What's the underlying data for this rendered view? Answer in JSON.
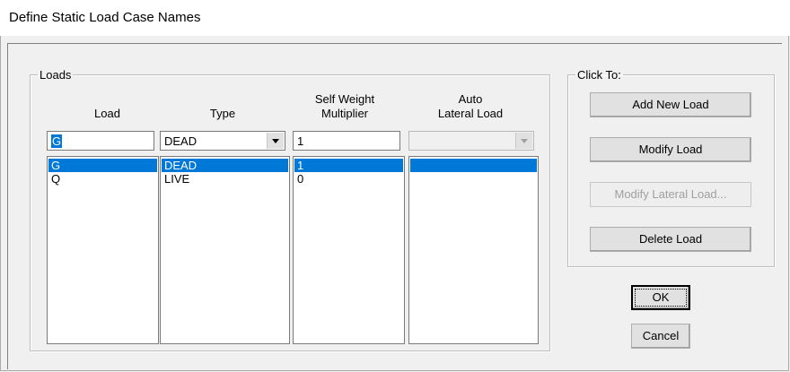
{
  "window": {
    "title": "Define Static Load Case Names"
  },
  "loads": {
    "legend": "Loads",
    "headers": {
      "load": "Load",
      "type": "Type",
      "self_weight": [
        "Self Weight",
        "Multiplier"
      ],
      "auto_lateral": [
        "Auto",
        "Lateral Load"
      ]
    },
    "edit_row": {
      "load": "G",
      "type": "DEAD",
      "multiplier": "1",
      "auto_lateral": ""
    },
    "rows": [
      {
        "load": "G",
        "type": "DEAD",
        "multiplier": "1",
        "selected": true
      },
      {
        "load": "Q",
        "type": "LIVE",
        "multiplier": "0",
        "selected": false
      }
    ]
  },
  "click_to": {
    "legend": "Click To:",
    "buttons": {
      "add": "Add New Load",
      "modify": "Modify Load",
      "modify_lateral": "Modify Lateral Load...",
      "delete": "Delete Load"
    }
  },
  "dialog_buttons": {
    "ok": "OK",
    "cancel": "Cancel"
  },
  "colors": {
    "selection": "#0078d7",
    "disabled_text": "#a0a0a0"
  }
}
